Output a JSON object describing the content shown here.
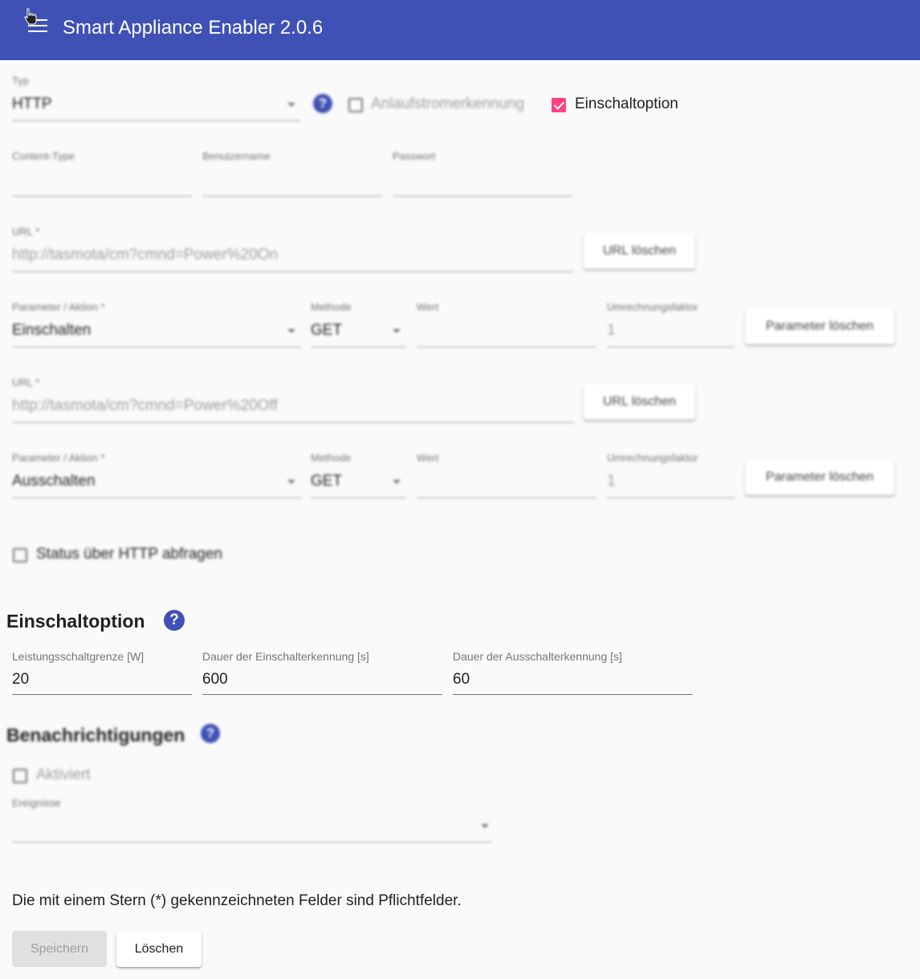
{
  "app": {
    "title": "Smart Appliance Enabler 2.0.6"
  },
  "top": {
    "typ_label": "Typ",
    "typ_value": "HTTP",
    "anlauf_label": "Anlaufstromerkennung",
    "einschalt_label": "Einschaltoption"
  },
  "auth": {
    "content_type_label": "Content-Type",
    "benutzer_label": "Benutzername",
    "passwort_label": "Passwort"
  },
  "urls": [
    {
      "url_label": "URL *",
      "url_value": "http://tasmota/cm?cmnd=Power%20On",
      "url_delete": "URL löschen",
      "param_label": "Parameter / Aktion *",
      "param_value": "Einschalten",
      "method_label": "Methode",
      "method_value": "GET",
      "wert_label": "Wert",
      "faktor_label": "Umrechnungsfaktor",
      "faktor_value": "1",
      "param_delete": "Parameter löschen"
    },
    {
      "url_label": "URL *",
      "url_value": "http://tasmota/cm?cmnd=Power%20Off",
      "url_delete": "URL löschen",
      "param_label": "Parameter / Aktion *",
      "param_value": "Ausschalten",
      "method_label": "Methode",
      "method_value": "GET",
      "wert_label": "Wert",
      "faktor_label": "Umrechnungsfaktor",
      "faktor_value": "1",
      "param_delete": "Parameter löschen"
    }
  ],
  "status": {
    "label": "Status über HTTP abfragen"
  },
  "einschaltoption": {
    "title": "Einschaltoption",
    "grenze_label": "Leistungsschaltgrenze [W]",
    "grenze_value": "20",
    "ein_label": "Dauer der Einschalterkennung [s]",
    "ein_value": "600",
    "aus_label": "Dauer der Ausschalterkennung [s]",
    "aus_value": "60"
  },
  "notifications": {
    "title": "Benachrichtigungen",
    "aktiviert_label": "Aktiviert",
    "ereignisse_label": "Ereignisse"
  },
  "footer": {
    "note": "Die mit einem Stern (*) gekennzeichneten Felder sind Pflichtfelder.",
    "save": "Speichern",
    "delete": "Löschen"
  },
  "colors": {
    "primary": "#3f51b5",
    "accent": "#ff4081"
  },
  "icons": {
    "menu": "menu-icon",
    "help": "help-icon",
    "cursor": "cursor-hand-icon"
  }
}
